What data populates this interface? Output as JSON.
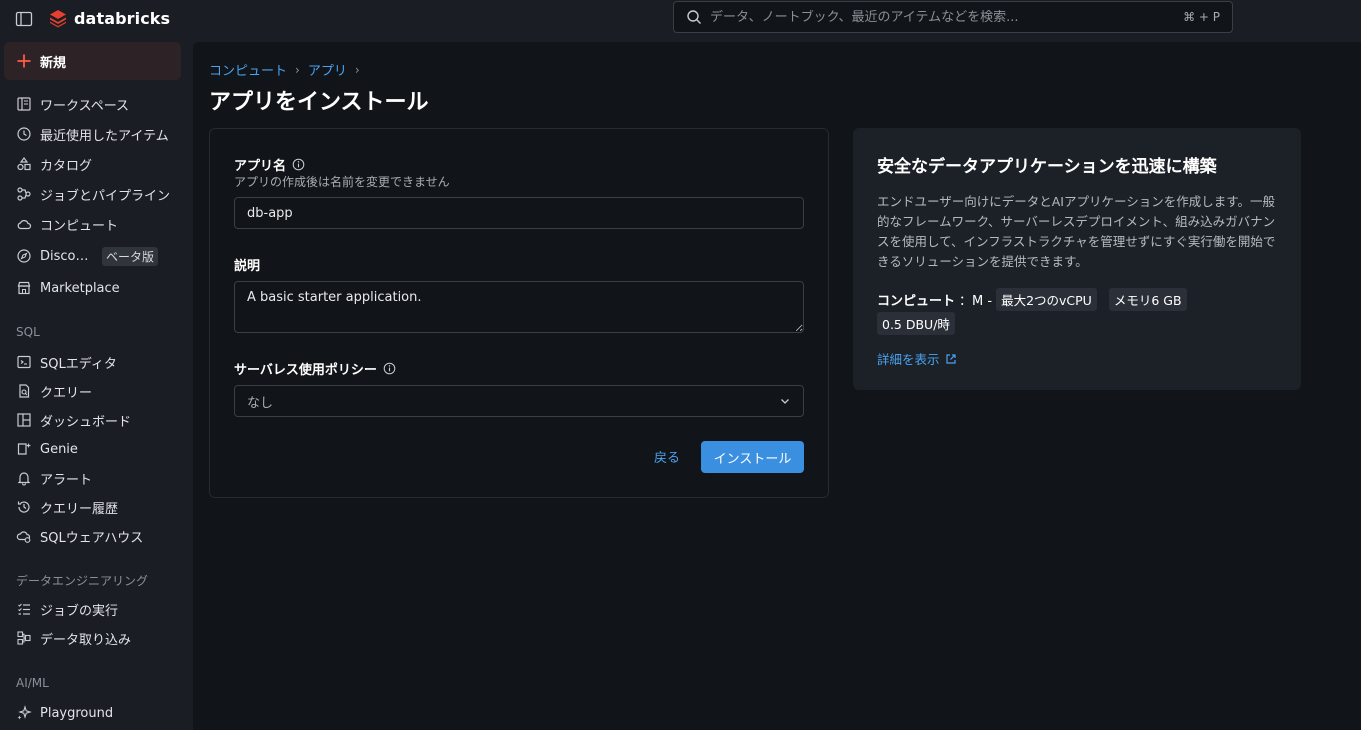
{
  "header": {
    "logo_text": "databricks",
    "search_placeholder": "データ、ノートブック、最近のアイテムなどを検索...",
    "search_shortcut": "⌘ + P"
  },
  "sidebar": {
    "new_label": "新規",
    "items": [
      {
        "label": "ワークスペース",
        "icon": "workspace-icon"
      },
      {
        "label": "最近使用したアイテム",
        "icon": "clock-icon"
      },
      {
        "label": "カタログ",
        "icon": "catalog-icon"
      },
      {
        "label": "ジョブとパイプライン",
        "icon": "jobs-pipelines-icon"
      },
      {
        "label": "コンピュート",
        "icon": "cloud-icon"
      },
      {
        "label": "Discover",
        "icon": "compass-icon",
        "badge": "ベータ版"
      },
      {
        "label": "Marketplace",
        "icon": "store-icon"
      }
    ],
    "sql_heading": "SQL",
    "sql_items": [
      {
        "label": "SQLエディタ",
        "icon": "sql-editor-icon"
      },
      {
        "label": "クエリー",
        "icon": "query-icon"
      },
      {
        "label": "ダッシュボード",
        "icon": "dashboard-icon"
      },
      {
        "label": "Genie",
        "icon": "genie-icon"
      },
      {
        "label": "アラート",
        "icon": "bell-icon"
      },
      {
        "label": "クエリー履歴",
        "icon": "history-icon"
      },
      {
        "label": "SQLウェアハウス",
        "icon": "warehouse-icon"
      }
    ],
    "de_heading": "データエンジニアリング",
    "de_items": [
      {
        "label": "ジョブの実行",
        "icon": "job-runs-icon"
      },
      {
        "label": "データ取り込み",
        "icon": "ingest-icon"
      }
    ],
    "ai_heading": "AI/ML",
    "ai_items": [
      {
        "label": "Playground",
        "icon": "sparkle-icon"
      }
    ]
  },
  "breadcrumb": {
    "items": [
      "コンピュート",
      "アプリ"
    ],
    "separator": "›"
  },
  "page": {
    "title": "アプリをインストール"
  },
  "form": {
    "app_name_label": "アプリ名",
    "app_name_hint": "アプリの作成後は名前を変更できません",
    "app_name_value": "db-app",
    "description_label": "説明",
    "description_value": "A basic starter application.",
    "policy_label": "サーバレス使用ポリシー",
    "policy_value": "なし",
    "back_label": "戻る",
    "install_label": "インストール"
  },
  "info": {
    "title": "安全なデータアプリケーションを迅速に構築",
    "description": "エンドユーザー向けにデータとAIアプリケーションを作成します。一般的なフレームワーク、サーバーレスデプロイメント、組み込みガバナンスを使用して、インフラストラクチャを管理せずにすぐ実行働を開始できるソリューションを提供できます。",
    "compute_key": "コンピュート",
    "compute_size": "：M -",
    "chip_vcpu": "最大2つのvCPU",
    "chip_memory": "メモリ6 GB",
    "chip_dbu": "0.5 DBU/時",
    "more_link": "詳細を表示"
  },
  "colors": {
    "accent": "#3b8fe0",
    "link": "#4aa3f0",
    "brand_red": "#e8402f",
    "new_icon": "#ff5a45"
  }
}
